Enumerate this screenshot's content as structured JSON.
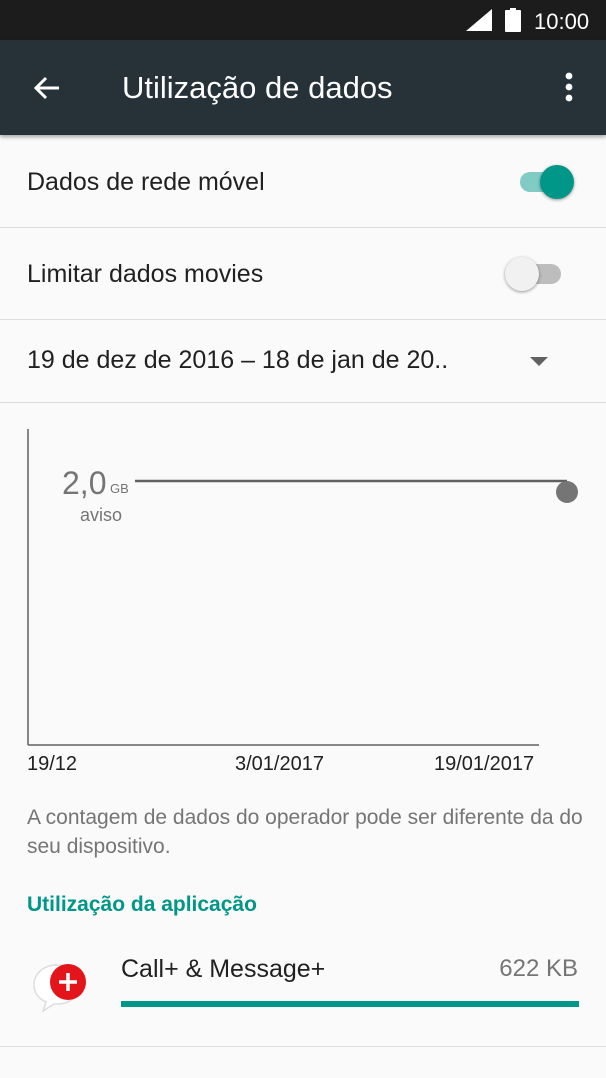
{
  "status_bar": {
    "time": "10:00"
  },
  "app_bar": {
    "title": "Utilização de dados"
  },
  "settings": {
    "mobile_data": {
      "label": "Dados de rede móvel",
      "enabled": true
    },
    "limit_data": {
      "label": "Limitar dados movies",
      "enabled": false
    },
    "cycle": {
      "label": "19 de dez de 2016 – 18 de jan de 20.."
    }
  },
  "usage_chart": {
    "warning_value": "2,0",
    "warning_unit": "GB",
    "warning_label": "aviso",
    "x_ticks": [
      "19/12",
      "3/01/2017",
      "19/01/2017"
    ]
  },
  "note": "A contagem de dados do operador pode ser diferente da do seu dispositivo.",
  "app_usage": {
    "header": "Utilização da aplicação",
    "apps": [
      {
        "name": "Call+ & Message+",
        "size": "622 KB",
        "usage_fraction": 1.0
      }
    ]
  },
  "colors": {
    "accent": "#009688",
    "app_bar": "#263238",
    "status_bar": "#1c1c1c"
  },
  "icons": {
    "back": "arrow-left-icon",
    "menu": "more-vert-icon",
    "dropdown": "caret-down-icon",
    "app": "call-message-plus-icon"
  }
}
